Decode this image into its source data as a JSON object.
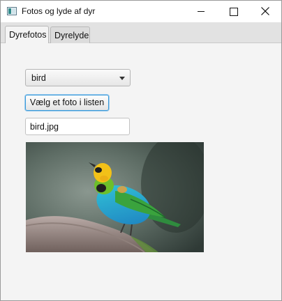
{
  "window": {
    "title": "Fotos og lyde af dyr"
  },
  "tabs": [
    {
      "label": "Dyrefotos",
      "selected": true
    },
    {
      "label": "Dyrelyde",
      "selected": false
    }
  ],
  "main": {
    "combo": {
      "selected": "bird"
    },
    "choose_button_label": "Vælg et foto i listen",
    "filename_field": {
      "value": "bird.jpg"
    },
    "photo": {
      "subject": "bird"
    }
  },
  "colors": {
    "focus_border": "#3a9ad9",
    "window_bg": "#f4f4f4",
    "tab_header_bg": "#e2e2e2"
  },
  "icons": [
    "app-icon",
    "minimize-icon",
    "maximize-icon",
    "close-icon",
    "chevron-down-icon"
  ]
}
